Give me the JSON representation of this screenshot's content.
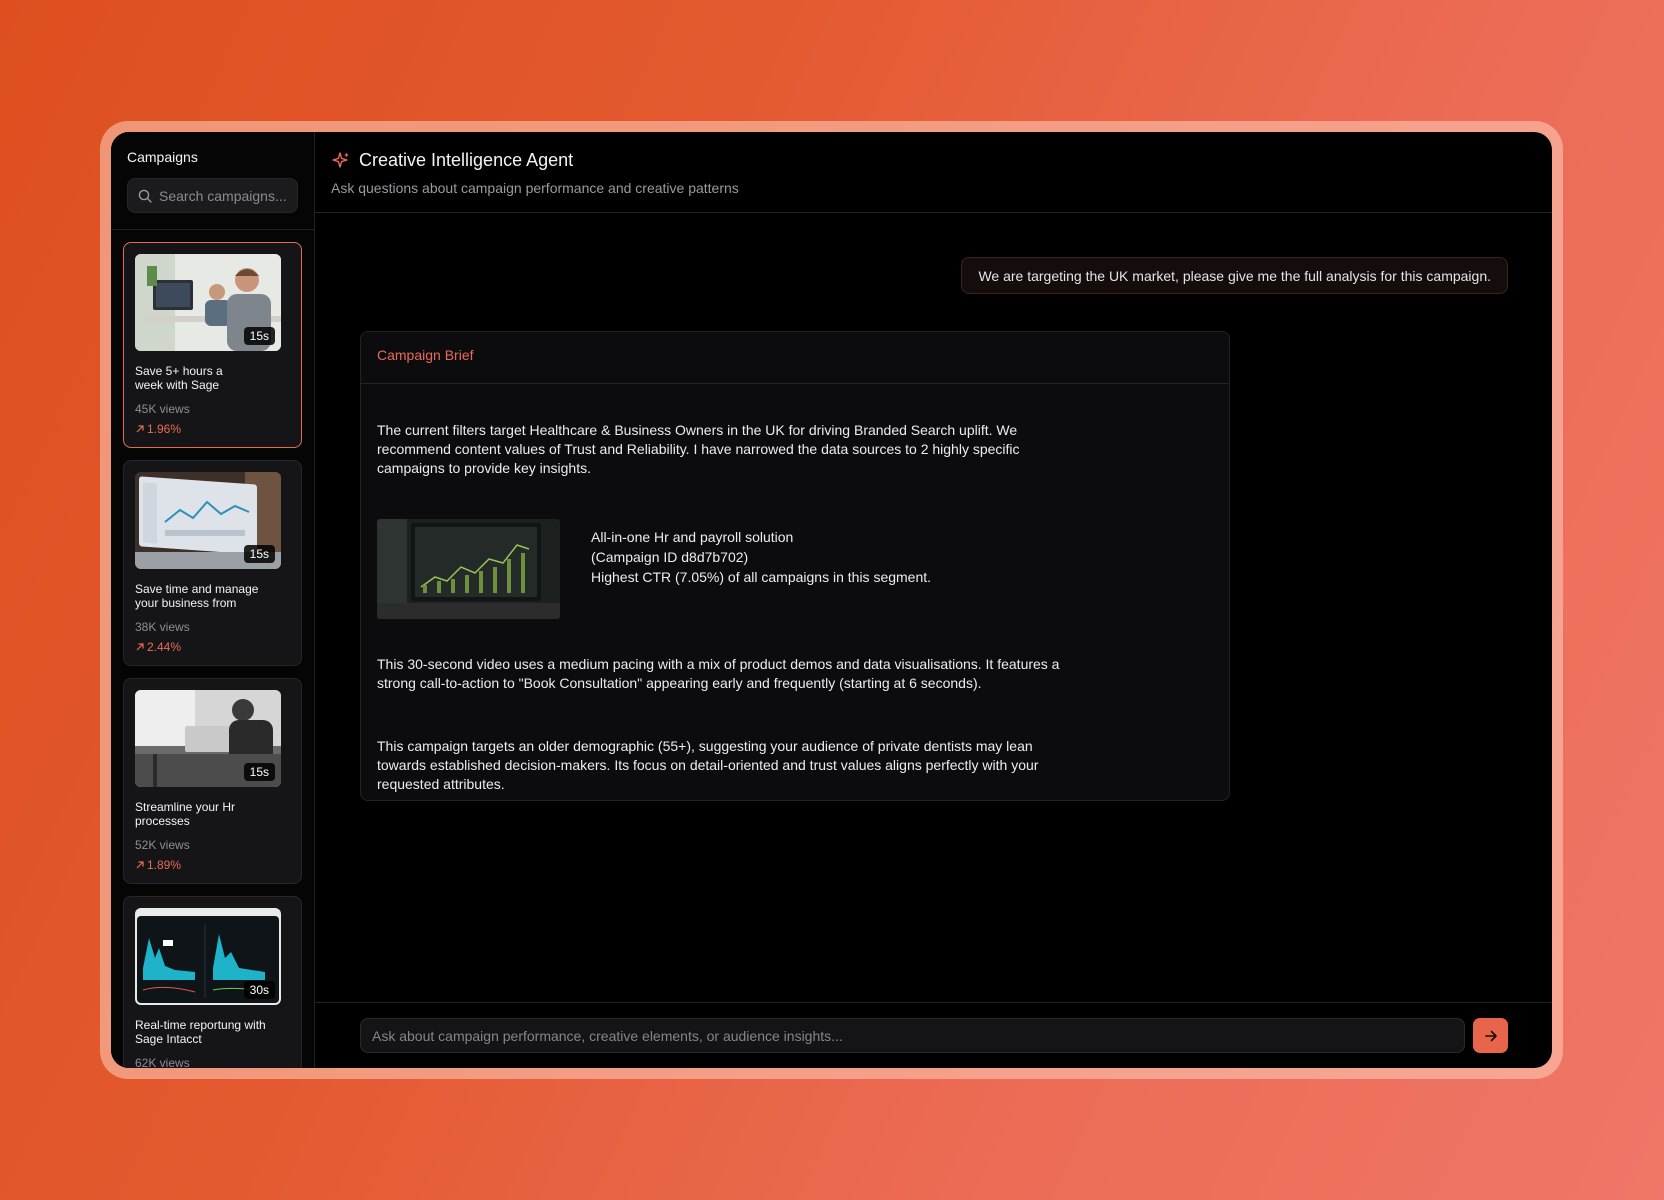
{
  "sidebar": {
    "title": "Campaigns",
    "search_placeholder": "Search campaigns...",
    "campaigns": [
      {
        "title": "Save 5+ hours a week with Sage",
        "views": "45K views",
        "ctr": "1.96%",
        "duration": "15s",
        "active": true
      },
      {
        "title": "Save time and manage your business from",
        "views": "38K views",
        "ctr": "2.44%",
        "duration": "15s"
      },
      {
        "title": "Streamline your Hr processes",
        "views": "52K views",
        "ctr": "1.89%",
        "duration": "15s"
      },
      {
        "title": "Real-time reportung with Sage Intacct",
        "views": "62K views",
        "duration": "30s"
      }
    ]
  },
  "header": {
    "title": "Creative Intelligence Agent",
    "subtitle": "Ask questions about campaign performance and creative patterns"
  },
  "chat": {
    "user_message": "We are targeting the UK market, please give me the full analysis for this campaign.",
    "brief": {
      "title": "Campaign Brief",
      "intro": "The current filters target Healthcare & Business Owners in the UK for driving Branded Search uplift. We recommend content values of Trust and Reliability. I have narrowed the data sources to 2 highly specific campaigns to provide key insights.",
      "featured": {
        "name": "All-in-one Hr and payroll solution",
        "campaign_id": "(Campaign ID d8d7b702)",
        "ctr_note": "Highest CTR (7.05%) of all campaigns in this segment."
      },
      "video_analysis": "This 30-second video uses a medium pacing with a mix of product demos and data visualisations. It features a strong call-to-action to \"Book Consultation\" appearing early and frequently (starting at 6 seconds).",
      "audience_analysis": "This campaign targets an older demographic (55+), suggesting your audience of private dentists may lean towards established decision-makers. Its focus on detail-oriented and trust values aligns perfectly with your requested attributes."
    }
  },
  "composer": {
    "placeholder": "Ask about campaign performance, creative elements, or audience insights..."
  },
  "colors": {
    "accent": "#e8654c",
    "background_gradient_start": "#dd4f1f",
    "background_gradient_end": "#f07667"
  }
}
